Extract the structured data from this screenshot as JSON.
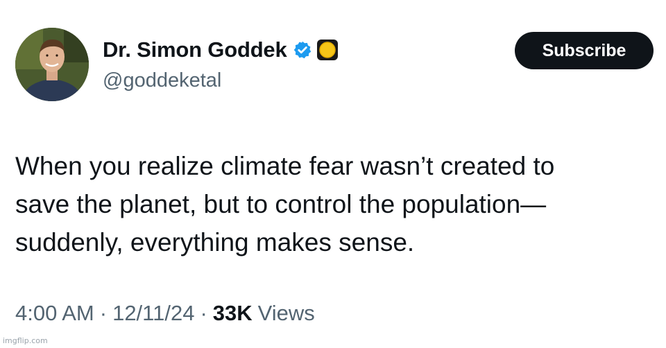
{
  "author": {
    "display_name": "Dr. Simon Goddek",
    "handle": "@goddeketal",
    "avatar_icon": "profile-photo",
    "verified_icon": "verified-badge-icon",
    "affiliate_icon": "affiliate-badge-icon"
  },
  "actions": {
    "subscribe_label": "Subscribe"
  },
  "tweet": {
    "lines": [
      "When you realize climate fear wasn’t created to",
      "save the planet, but to control the population—",
      "suddenly, everything makes sense."
    ]
  },
  "meta": {
    "time": "4:00 AM",
    "date": "12/11/24",
    "separator": "·",
    "views_count": "33K",
    "views_label": "Views"
  },
  "watermark": {
    "text": "imgflip.com"
  },
  "colors": {
    "text_primary": "#0f1419",
    "text_secondary": "#536471",
    "verified_blue": "#1d9bf0",
    "button_bg": "#0f1419",
    "badge_gold": "#f5c518"
  }
}
